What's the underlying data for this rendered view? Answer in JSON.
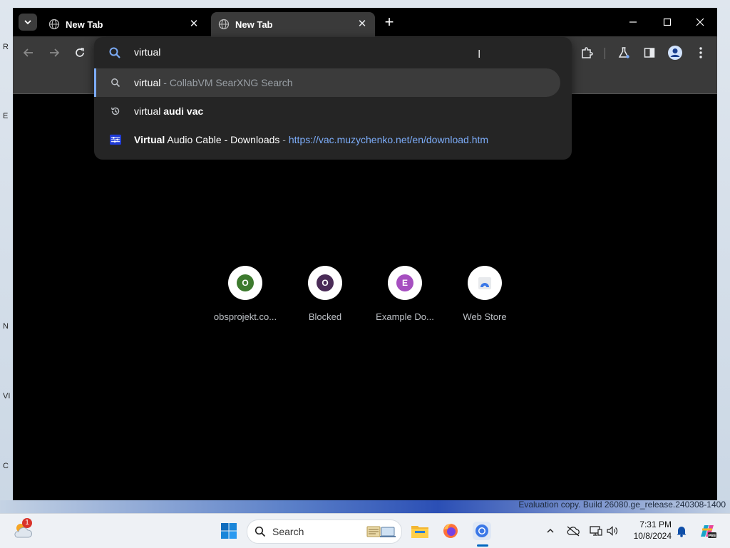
{
  "tabs": [
    {
      "title": "New Tab"
    },
    {
      "title": "New Tab"
    }
  ],
  "omnibox": {
    "input_value": "virtual",
    "suggestions": [
      {
        "type": "search",
        "query": "virtual",
        "separator": " - ",
        "provider": "CollabVM SearXNG Search"
      },
      {
        "type": "history",
        "prefix": "virtual ",
        "completion": "audi vac"
      },
      {
        "type": "site",
        "title_bold": "Virtual",
        "title_rest": " Audio Cable - Downloads",
        "separator": " - ",
        "url": "https://vac.muzychenko.net/en/download.htm"
      }
    ]
  },
  "shortcuts": [
    {
      "letter": "O",
      "label": "obsprojekt.co...",
      "color": "#3d7a2e"
    },
    {
      "letter": "O",
      "label": "Blocked",
      "color": "#4a2b57"
    },
    {
      "letter": "E",
      "label": "Example Do...",
      "color": "#a64fc0"
    },
    {
      "letter": "",
      "label": "Web Store",
      "color": "#3b78e7"
    }
  ],
  "watermark": "Evaluation copy. Build 26080.ge_release.240308-1400",
  "taskbar": {
    "search_label": "Search",
    "time": "7:31 PM",
    "date": "10/8/2024",
    "weather_badge": "1"
  },
  "desktop_labels": [
    "R",
    "E",
    "N",
    "VI",
    "C"
  ],
  "colors": {
    "accent": "#7cacf8",
    "browser_bg": "#000000",
    "toolbar": "#3a3a3a"
  }
}
